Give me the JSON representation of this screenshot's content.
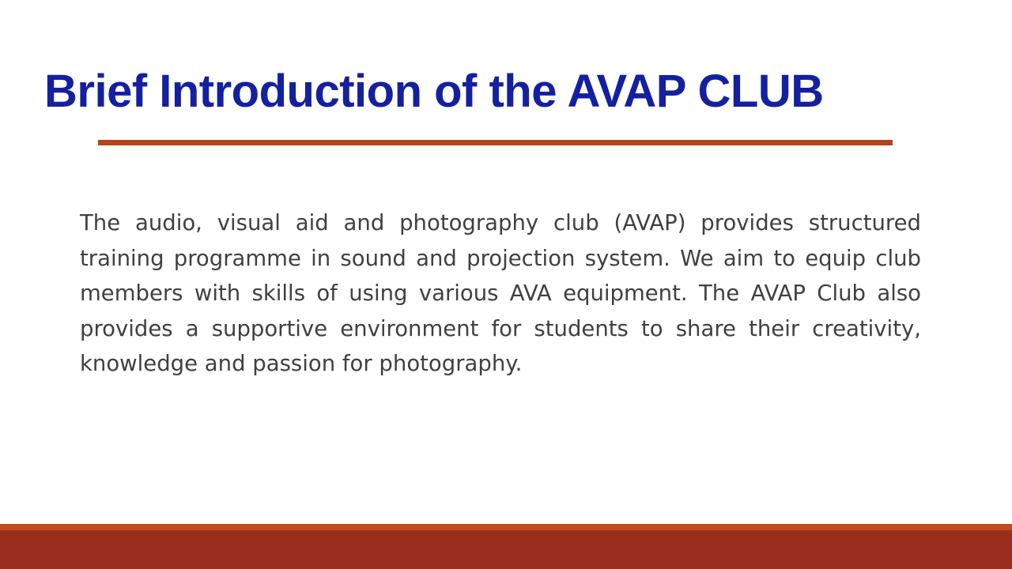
{
  "slide": {
    "title": "Brief Introduction of the AVAP CLUB",
    "body": "The audio, visual aid and photography club (AVAP) provides structured training programme in sound and projection system. We aim to equip club members with skills of using various AVA equipment. The AVAP Club also provides a supportive environment for students to share their creativity, knowledge and passion for photography."
  },
  "colors": {
    "title": "#1420a0",
    "accent_rule": "#b4441c",
    "body_text": "#404040",
    "footer": "#9a2e1e",
    "footer_highlight": "#c44a1c"
  }
}
